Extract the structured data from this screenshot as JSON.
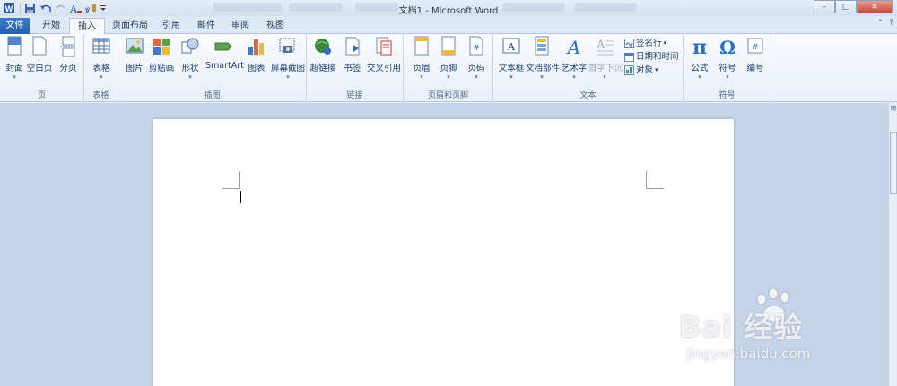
{
  "window": {
    "title": "文档1 - Microsoft Word",
    "controls": [
      "–",
      "□",
      "✕"
    ]
  },
  "tabs": [
    {
      "label": "文件"
    },
    {
      "label": "开始"
    },
    {
      "label": "插入"
    },
    {
      "label": "页面布局"
    },
    {
      "label": "引用"
    },
    {
      "label": "邮件"
    },
    {
      "label": "审阅"
    },
    {
      "label": "视图"
    }
  ],
  "active_tab": "插入",
  "ribbon": {
    "groups": {
      "pages": {
        "label": "页",
        "buttons": [
          "封面",
          "空白页",
          "分页"
        ]
      },
      "tables": {
        "label": "表格",
        "buttons": [
          "表格"
        ]
      },
      "illustrations": {
        "label": "插图",
        "buttons": [
          "图片",
          "剪贴画",
          "形状",
          "SmartArt",
          "图表",
          "屏幕截图"
        ]
      },
      "links": {
        "label": "链接",
        "buttons": [
          "超链接",
          "书签",
          "交叉引用"
        ]
      },
      "header_footer": {
        "label": "页眉和页脚",
        "buttons": [
          "页眉",
          "页脚",
          "页码"
        ]
      },
      "text": {
        "label": "文本",
        "buttons": [
          "文本框",
          "文档部件",
          "艺术字",
          "首字下沉"
        ],
        "small": [
          "签名行",
          "日期和时间",
          "对象"
        ]
      },
      "symbols": {
        "label": "符号",
        "buttons": [
          "公式",
          "符号",
          "编号"
        ]
      }
    }
  },
  "watermark": {
    "main": "Bai 经验",
    "sub": "jingyan.baidu.com"
  },
  "colors": {
    "file_tab": "#2a5fad",
    "ribbon_bg": "#f2f6fb",
    "doc_bg": "#c5d4e8"
  }
}
